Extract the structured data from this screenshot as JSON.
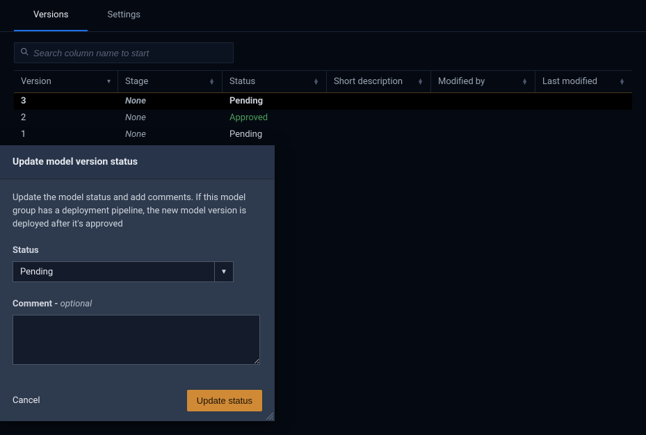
{
  "tabs": {
    "versions": "Versions",
    "settings": "Settings"
  },
  "search": {
    "placeholder": "Search column name to start"
  },
  "table": {
    "headers": {
      "version": "Version",
      "stage": "Stage",
      "status": "Status",
      "short_description": "Short description",
      "modified_by": "Modified by",
      "last_modified": "Last modified"
    },
    "rows": [
      {
        "version": "3",
        "stage": "None",
        "status": "Pending",
        "short_description": "",
        "modified_by": "",
        "last_modified": "",
        "status_kind": "pending",
        "selected": true
      },
      {
        "version": "2",
        "stage": "None",
        "status": "Approved",
        "short_description": "",
        "modified_by": "",
        "last_modified": "",
        "status_kind": "approved",
        "selected": false
      },
      {
        "version": "1",
        "stage": "None",
        "status": "Pending",
        "short_description": "",
        "modified_by": "",
        "last_modified": "",
        "status_kind": "pending",
        "selected": false
      }
    ]
  },
  "modal": {
    "title": "Update model version status",
    "description": "Update the model status and add comments. If this model group has a deployment pipeline, the new model version is deployed after it's approved",
    "status_label": "Status",
    "status_value": "Pending",
    "comment_label": "Comment - ",
    "comment_optional": "optional",
    "comment_value": "",
    "cancel": "Cancel",
    "submit": "Update status"
  }
}
